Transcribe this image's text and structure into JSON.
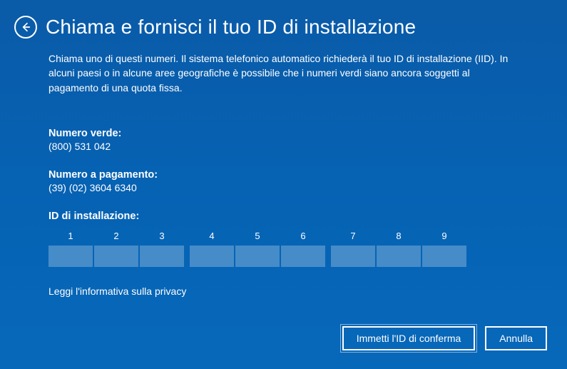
{
  "header": {
    "title": "Chiama e fornisci il tuo ID di installazione"
  },
  "description": "Chiama uno di questi numeri. Il sistema telefonico automatico richiederà il tuo ID di installazione (IID). In alcuni paesi o in alcune aree geografiche è possibile che i numeri verdi siano ancora soggetti al pagamento di una quota fissa.",
  "tollfree": {
    "label": "Numero verde:",
    "number": "(800) 531 042"
  },
  "toll": {
    "label": "Numero a pagamento:",
    "number": "(39) (02) 3604 6340"
  },
  "installId": {
    "label": "ID di installazione:",
    "blocks": [
      "1",
      "2",
      "3",
      "4",
      "5",
      "6",
      "7",
      "8",
      "9"
    ]
  },
  "privacyLink": "Leggi l'informativa sulla privacy",
  "buttons": {
    "confirm": "Immetti l'ID di conferma",
    "cancel": "Annulla"
  }
}
